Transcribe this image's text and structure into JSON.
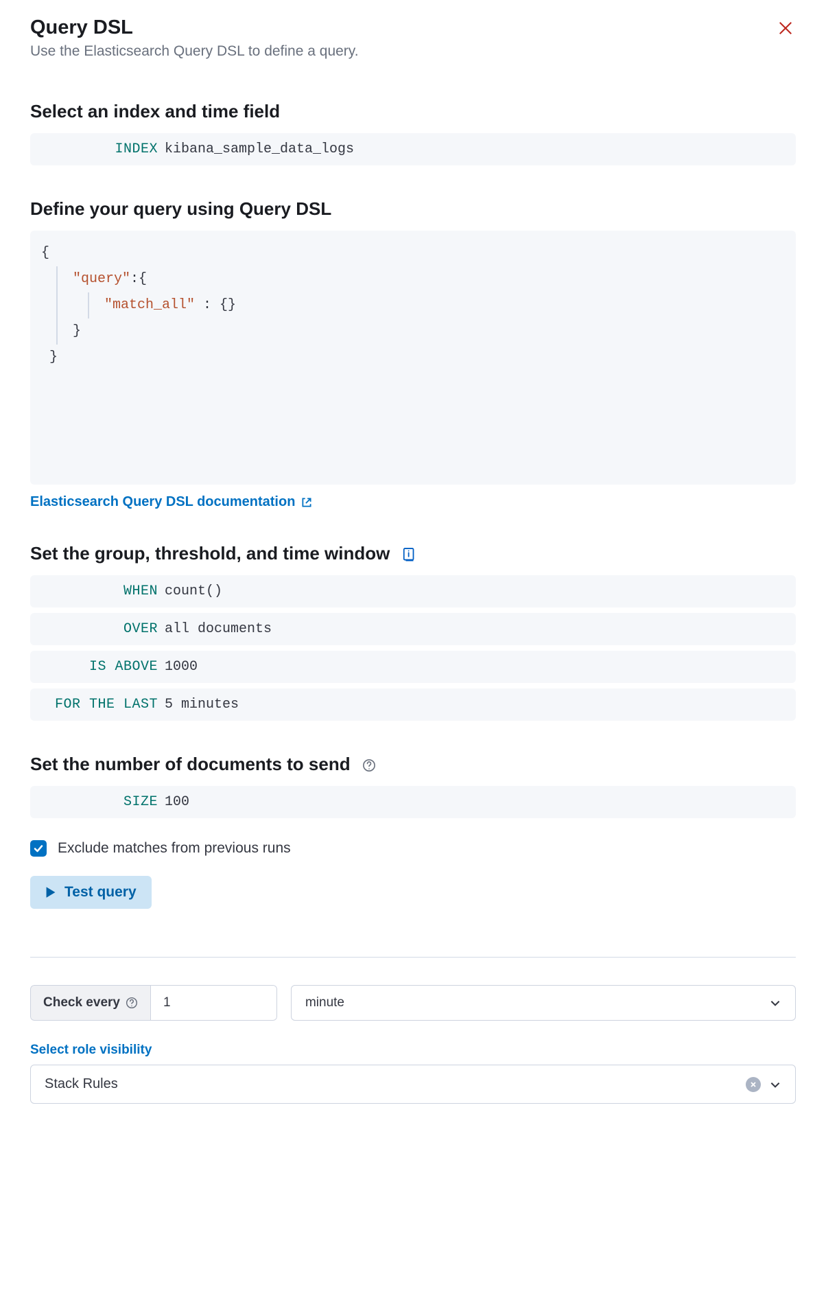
{
  "header": {
    "title": "Query DSL",
    "subtitle": "Use the Elasticsearch Query DSL to define a query."
  },
  "sections": {
    "index": {
      "title": "Select an index and time field",
      "key": "INDEX",
      "value": "kibana_sample_data_logs"
    },
    "query": {
      "title": "Define your query using Query DSL",
      "code_key1": "\"query\"",
      "code_key2": "\"match_all\"",
      "doc_link": "Elasticsearch Query DSL documentation"
    },
    "threshold": {
      "title": "Set the group, threshold, and time window",
      "rows": {
        "when_key": "WHEN",
        "when_val": "count()",
        "over_key": "OVER",
        "over_val": "all documents",
        "above_key": "IS ABOVE",
        "above_val": "1000",
        "last_key": "FOR THE LAST",
        "last_val": "5 minutes"
      }
    },
    "size": {
      "title": "Set the number of documents to send",
      "key": "SIZE",
      "value": "100"
    }
  },
  "exclude_label": "Exclude matches from previous runs",
  "test_button": "Test query",
  "check_every": {
    "label": "Check every",
    "value": "1",
    "unit": "minute"
  },
  "role": {
    "label": "Select role visibility",
    "value": "Stack Rules"
  }
}
